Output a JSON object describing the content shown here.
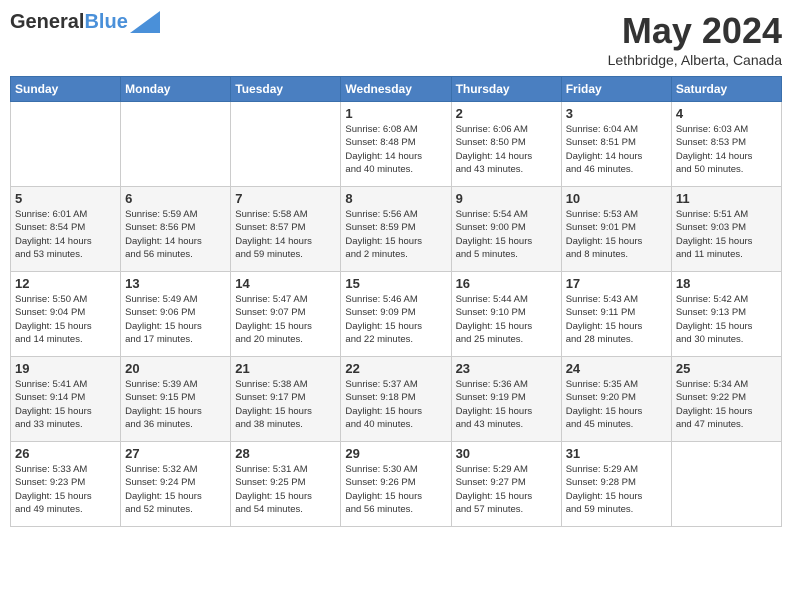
{
  "logo": {
    "line1": "General",
    "line2": "Blue"
  },
  "title": "May 2024",
  "location": "Lethbridge, Alberta, Canada",
  "days_of_week": [
    "Sunday",
    "Monday",
    "Tuesday",
    "Wednesday",
    "Thursday",
    "Friday",
    "Saturday"
  ],
  "weeks": [
    [
      {
        "day": "",
        "info": ""
      },
      {
        "day": "",
        "info": ""
      },
      {
        "day": "",
        "info": ""
      },
      {
        "day": "1",
        "info": "Sunrise: 6:08 AM\nSunset: 8:48 PM\nDaylight: 14 hours\nand 40 minutes."
      },
      {
        "day": "2",
        "info": "Sunrise: 6:06 AM\nSunset: 8:50 PM\nDaylight: 14 hours\nand 43 minutes."
      },
      {
        "day": "3",
        "info": "Sunrise: 6:04 AM\nSunset: 8:51 PM\nDaylight: 14 hours\nand 46 minutes."
      },
      {
        "day": "4",
        "info": "Sunrise: 6:03 AM\nSunset: 8:53 PM\nDaylight: 14 hours\nand 50 minutes."
      }
    ],
    [
      {
        "day": "5",
        "info": "Sunrise: 6:01 AM\nSunset: 8:54 PM\nDaylight: 14 hours\nand 53 minutes."
      },
      {
        "day": "6",
        "info": "Sunrise: 5:59 AM\nSunset: 8:56 PM\nDaylight: 14 hours\nand 56 minutes."
      },
      {
        "day": "7",
        "info": "Sunrise: 5:58 AM\nSunset: 8:57 PM\nDaylight: 14 hours\nand 59 minutes."
      },
      {
        "day": "8",
        "info": "Sunrise: 5:56 AM\nSunset: 8:59 PM\nDaylight: 15 hours\nand 2 minutes."
      },
      {
        "day": "9",
        "info": "Sunrise: 5:54 AM\nSunset: 9:00 PM\nDaylight: 15 hours\nand 5 minutes."
      },
      {
        "day": "10",
        "info": "Sunrise: 5:53 AM\nSunset: 9:01 PM\nDaylight: 15 hours\nand 8 minutes."
      },
      {
        "day": "11",
        "info": "Sunrise: 5:51 AM\nSunset: 9:03 PM\nDaylight: 15 hours\nand 11 minutes."
      }
    ],
    [
      {
        "day": "12",
        "info": "Sunrise: 5:50 AM\nSunset: 9:04 PM\nDaylight: 15 hours\nand 14 minutes."
      },
      {
        "day": "13",
        "info": "Sunrise: 5:49 AM\nSunset: 9:06 PM\nDaylight: 15 hours\nand 17 minutes."
      },
      {
        "day": "14",
        "info": "Sunrise: 5:47 AM\nSunset: 9:07 PM\nDaylight: 15 hours\nand 20 minutes."
      },
      {
        "day": "15",
        "info": "Sunrise: 5:46 AM\nSunset: 9:09 PM\nDaylight: 15 hours\nand 22 minutes."
      },
      {
        "day": "16",
        "info": "Sunrise: 5:44 AM\nSunset: 9:10 PM\nDaylight: 15 hours\nand 25 minutes."
      },
      {
        "day": "17",
        "info": "Sunrise: 5:43 AM\nSunset: 9:11 PM\nDaylight: 15 hours\nand 28 minutes."
      },
      {
        "day": "18",
        "info": "Sunrise: 5:42 AM\nSunset: 9:13 PM\nDaylight: 15 hours\nand 30 minutes."
      }
    ],
    [
      {
        "day": "19",
        "info": "Sunrise: 5:41 AM\nSunset: 9:14 PM\nDaylight: 15 hours\nand 33 minutes."
      },
      {
        "day": "20",
        "info": "Sunrise: 5:39 AM\nSunset: 9:15 PM\nDaylight: 15 hours\nand 36 minutes."
      },
      {
        "day": "21",
        "info": "Sunrise: 5:38 AM\nSunset: 9:17 PM\nDaylight: 15 hours\nand 38 minutes."
      },
      {
        "day": "22",
        "info": "Sunrise: 5:37 AM\nSunset: 9:18 PM\nDaylight: 15 hours\nand 40 minutes."
      },
      {
        "day": "23",
        "info": "Sunrise: 5:36 AM\nSunset: 9:19 PM\nDaylight: 15 hours\nand 43 minutes."
      },
      {
        "day": "24",
        "info": "Sunrise: 5:35 AM\nSunset: 9:20 PM\nDaylight: 15 hours\nand 45 minutes."
      },
      {
        "day": "25",
        "info": "Sunrise: 5:34 AM\nSunset: 9:22 PM\nDaylight: 15 hours\nand 47 minutes."
      }
    ],
    [
      {
        "day": "26",
        "info": "Sunrise: 5:33 AM\nSunset: 9:23 PM\nDaylight: 15 hours\nand 49 minutes."
      },
      {
        "day": "27",
        "info": "Sunrise: 5:32 AM\nSunset: 9:24 PM\nDaylight: 15 hours\nand 52 minutes."
      },
      {
        "day": "28",
        "info": "Sunrise: 5:31 AM\nSunset: 9:25 PM\nDaylight: 15 hours\nand 54 minutes."
      },
      {
        "day": "29",
        "info": "Sunrise: 5:30 AM\nSunset: 9:26 PM\nDaylight: 15 hours\nand 56 minutes."
      },
      {
        "day": "30",
        "info": "Sunrise: 5:29 AM\nSunset: 9:27 PM\nDaylight: 15 hours\nand 57 minutes."
      },
      {
        "day": "31",
        "info": "Sunrise: 5:29 AM\nSunset: 9:28 PM\nDaylight: 15 hours\nand 59 minutes."
      },
      {
        "day": "",
        "info": ""
      }
    ]
  ]
}
